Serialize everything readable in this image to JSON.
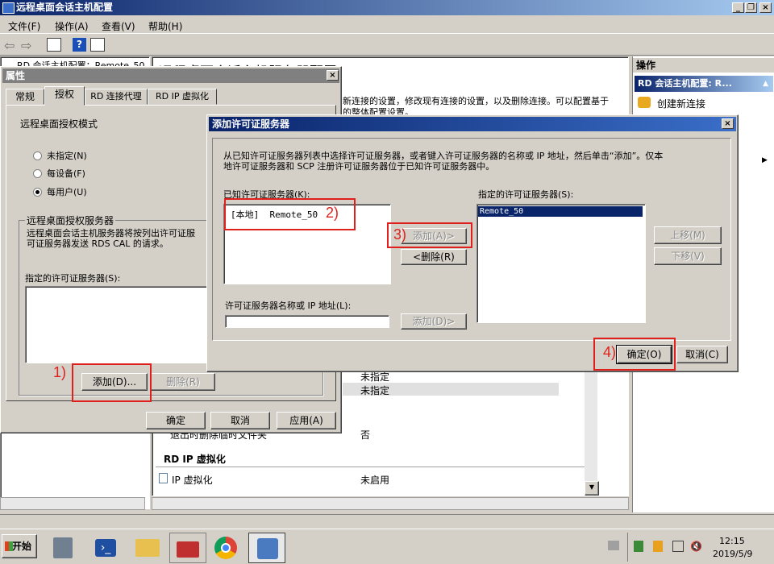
{
  "main_window": {
    "title": "远程桌面会话主机配置",
    "menu": [
      "文件(F)",
      "操作(A)",
      "查看(V)",
      "帮助(H)"
    ],
    "tree_item": "RD 会话主机配置：Remote_50",
    "content_heading": "远程桌面会话主机服务器配置：",
    "content_desc_line1": "新连接的设置，修改现有连接的设置，以及删除连接。可以配置基于",
    "content_desc_line2": "的整体配置设置。",
    "rows": [
      {
        "label": "",
        "value": "未指定"
      },
      {
        "label": "",
        "value": "未指定"
      },
      {
        "label": "退出时删除临时文件夹",
        "value": "否"
      }
    ],
    "section_rd_ip": "RD IP 虚拟化",
    "ip_row": {
      "label": "IP 虚拟化",
      "value": "未启用"
    }
  },
  "actions_pane": {
    "title": "操作",
    "header": "RD 会话主机配置: R...",
    "create_connection": "创建新连接"
  },
  "properties_dialog": {
    "title": "属性",
    "tabs": [
      "常规",
      "授权",
      "RD 连接代理",
      "RD IP 虚拟化"
    ],
    "licensing_mode_label": "远程桌面授权模式",
    "radios": [
      {
        "label": "未指定(N)",
        "selected": false
      },
      {
        "label": "每设备(F)",
        "selected": false
      },
      {
        "label": "每用户(U)",
        "selected": true
      }
    ],
    "group_label": "远程桌面授权服务器",
    "group_desc_line1": "远程桌面会话主机服务器将按列出许可证服",
    "group_desc_line2": "可证服务器发送 RDS CAL 的请求。",
    "specified_servers_label": "指定的许可证服务器(S):",
    "add_button": "添加(D)...",
    "remove_button": "删除(R)",
    "ok_button": "确定",
    "cancel_button": "取消",
    "apply_button": "应用(A)"
  },
  "add_dialog": {
    "title": "添加许可证服务器",
    "desc_line1": "从已知许可证服务器列表中选择许可证服务器，或者键入许可证服务器的名称或 IP 地址，然后单击“添加”。仅本",
    "desc_line2": "地许可证服务器和 SCP 注册许可证服务器位于已知许可证服务器中。",
    "known_label": "已知许可证服务器(K):",
    "known_items": [
      "[本地]  Remote_50"
    ],
    "add_button": "添加(A)>",
    "remove_button": "<删除(R)",
    "name_ip_label": "许可证服务器名称或 IP 地址(L):",
    "name_ip_value": "",
    "add_by_name_button": "添加(D)>",
    "specified_label": "指定的许可证服务器(S):",
    "specified_items": [
      "Remote_50"
    ],
    "move_up_button": "上移(M)",
    "move_down_button": "下移(V)",
    "ok_button": "确定(O)",
    "cancel_button": "取消(C)"
  },
  "annotations": [
    "1)",
    "2)",
    "3)",
    "4)"
  ],
  "taskbar": {
    "start": "开始",
    "time": "12:15",
    "date": "2019/5/9"
  },
  "colors": {
    "title_active": "#0a246a",
    "title_inactive": "#808080",
    "selection": "#0a246a",
    "annotation": "#e0201c"
  }
}
